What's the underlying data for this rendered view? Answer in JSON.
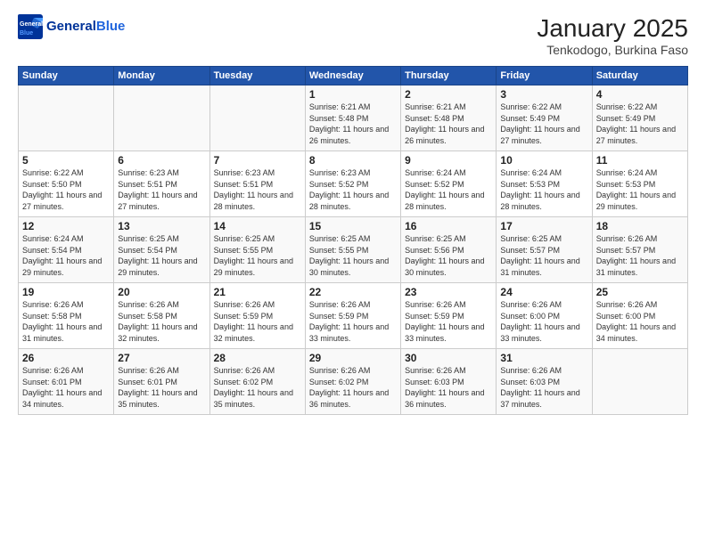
{
  "header": {
    "logo_line1": "General",
    "logo_line2": "Blue",
    "title": "January 2025",
    "subtitle": "Tenkodogo, Burkina Faso"
  },
  "weekdays": [
    "Sunday",
    "Monday",
    "Tuesday",
    "Wednesday",
    "Thursday",
    "Friday",
    "Saturday"
  ],
  "weeks": [
    [
      {
        "day": "",
        "info": ""
      },
      {
        "day": "",
        "info": ""
      },
      {
        "day": "",
        "info": ""
      },
      {
        "day": "1",
        "info": "Sunrise: 6:21 AM\nSunset: 5:48 PM\nDaylight: 11 hours\nand 26 minutes."
      },
      {
        "day": "2",
        "info": "Sunrise: 6:21 AM\nSunset: 5:48 PM\nDaylight: 11 hours\nand 26 minutes."
      },
      {
        "day": "3",
        "info": "Sunrise: 6:22 AM\nSunset: 5:49 PM\nDaylight: 11 hours\nand 27 minutes."
      },
      {
        "day": "4",
        "info": "Sunrise: 6:22 AM\nSunset: 5:49 PM\nDaylight: 11 hours\nand 27 minutes."
      }
    ],
    [
      {
        "day": "5",
        "info": "Sunrise: 6:22 AM\nSunset: 5:50 PM\nDaylight: 11 hours\nand 27 minutes."
      },
      {
        "day": "6",
        "info": "Sunrise: 6:23 AM\nSunset: 5:51 PM\nDaylight: 11 hours\nand 27 minutes."
      },
      {
        "day": "7",
        "info": "Sunrise: 6:23 AM\nSunset: 5:51 PM\nDaylight: 11 hours\nand 28 minutes."
      },
      {
        "day": "8",
        "info": "Sunrise: 6:23 AM\nSunset: 5:52 PM\nDaylight: 11 hours\nand 28 minutes."
      },
      {
        "day": "9",
        "info": "Sunrise: 6:24 AM\nSunset: 5:52 PM\nDaylight: 11 hours\nand 28 minutes."
      },
      {
        "day": "10",
        "info": "Sunrise: 6:24 AM\nSunset: 5:53 PM\nDaylight: 11 hours\nand 28 minutes."
      },
      {
        "day": "11",
        "info": "Sunrise: 6:24 AM\nSunset: 5:53 PM\nDaylight: 11 hours\nand 29 minutes."
      }
    ],
    [
      {
        "day": "12",
        "info": "Sunrise: 6:24 AM\nSunset: 5:54 PM\nDaylight: 11 hours\nand 29 minutes."
      },
      {
        "day": "13",
        "info": "Sunrise: 6:25 AM\nSunset: 5:54 PM\nDaylight: 11 hours\nand 29 minutes."
      },
      {
        "day": "14",
        "info": "Sunrise: 6:25 AM\nSunset: 5:55 PM\nDaylight: 11 hours\nand 29 minutes."
      },
      {
        "day": "15",
        "info": "Sunrise: 6:25 AM\nSunset: 5:55 PM\nDaylight: 11 hours\nand 30 minutes."
      },
      {
        "day": "16",
        "info": "Sunrise: 6:25 AM\nSunset: 5:56 PM\nDaylight: 11 hours\nand 30 minutes."
      },
      {
        "day": "17",
        "info": "Sunrise: 6:25 AM\nSunset: 5:57 PM\nDaylight: 11 hours\nand 31 minutes."
      },
      {
        "day": "18",
        "info": "Sunrise: 6:26 AM\nSunset: 5:57 PM\nDaylight: 11 hours\nand 31 minutes."
      }
    ],
    [
      {
        "day": "19",
        "info": "Sunrise: 6:26 AM\nSunset: 5:58 PM\nDaylight: 11 hours\nand 31 minutes."
      },
      {
        "day": "20",
        "info": "Sunrise: 6:26 AM\nSunset: 5:58 PM\nDaylight: 11 hours\nand 32 minutes."
      },
      {
        "day": "21",
        "info": "Sunrise: 6:26 AM\nSunset: 5:59 PM\nDaylight: 11 hours\nand 32 minutes."
      },
      {
        "day": "22",
        "info": "Sunrise: 6:26 AM\nSunset: 5:59 PM\nDaylight: 11 hours\nand 33 minutes."
      },
      {
        "day": "23",
        "info": "Sunrise: 6:26 AM\nSunset: 5:59 PM\nDaylight: 11 hours\nand 33 minutes."
      },
      {
        "day": "24",
        "info": "Sunrise: 6:26 AM\nSunset: 6:00 PM\nDaylight: 11 hours\nand 33 minutes."
      },
      {
        "day": "25",
        "info": "Sunrise: 6:26 AM\nSunset: 6:00 PM\nDaylight: 11 hours\nand 34 minutes."
      }
    ],
    [
      {
        "day": "26",
        "info": "Sunrise: 6:26 AM\nSunset: 6:01 PM\nDaylight: 11 hours\nand 34 minutes."
      },
      {
        "day": "27",
        "info": "Sunrise: 6:26 AM\nSunset: 6:01 PM\nDaylight: 11 hours\nand 35 minutes."
      },
      {
        "day": "28",
        "info": "Sunrise: 6:26 AM\nSunset: 6:02 PM\nDaylight: 11 hours\nand 35 minutes."
      },
      {
        "day": "29",
        "info": "Sunrise: 6:26 AM\nSunset: 6:02 PM\nDaylight: 11 hours\nand 36 minutes."
      },
      {
        "day": "30",
        "info": "Sunrise: 6:26 AM\nSunset: 6:03 PM\nDaylight: 11 hours\nand 36 minutes."
      },
      {
        "day": "31",
        "info": "Sunrise: 6:26 AM\nSunset: 6:03 PM\nDaylight: 11 hours\nand 37 minutes."
      },
      {
        "day": "",
        "info": ""
      }
    ]
  ]
}
